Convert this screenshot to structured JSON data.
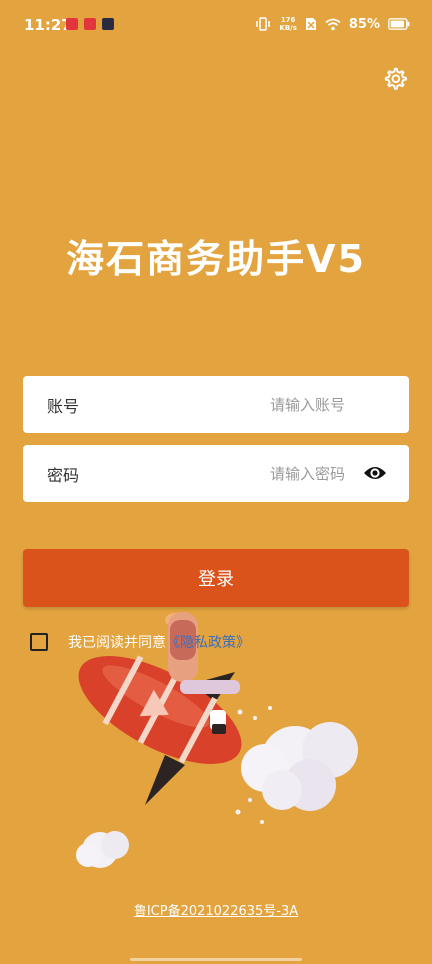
{
  "status_bar": {
    "time": "11:27",
    "net_speed_value": "176",
    "net_speed_unit": "KB/s",
    "battery": "85%"
  },
  "app": {
    "title": "海石商务助手V5"
  },
  "form": {
    "account_label": "账号",
    "account_placeholder": "请输入账号",
    "password_label": "密码",
    "password_placeholder": "请输入密码",
    "login_button": "登录"
  },
  "agreement": {
    "text": "我已阅读并同意",
    "link": "《隐私政策》",
    "checked": false
  },
  "footer": {
    "icp": "鲁ICP备2021022635号-3A"
  },
  "icons": {
    "settings": "gear-icon",
    "password_visibility": "eye-icon"
  },
  "colors": {
    "background": "#E3A33E",
    "button": "#D9531A",
    "link": "#3E6FB8"
  }
}
